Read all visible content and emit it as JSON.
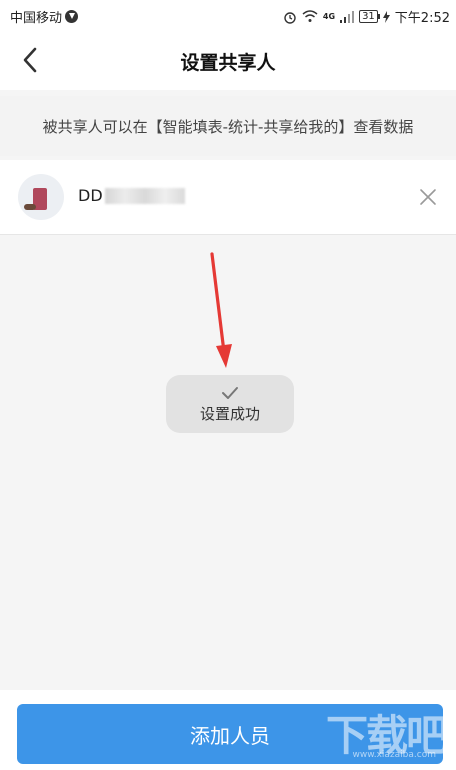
{
  "status_bar": {
    "carrier": "中国移动",
    "battery": "31",
    "time": "下午2:52",
    "network": "4G"
  },
  "header": {
    "title": "设置共享人",
    "back_icon": "chevron-left-icon"
  },
  "notice": {
    "text": "被共享人可以在【智能填表-统计-共享给我的】查看数据"
  },
  "shared_users": [
    {
      "name_visible": "DD",
      "remove_icon": "close-icon"
    }
  ],
  "toast": {
    "icon": "checkmark-icon",
    "text": "设置成功"
  },
  "footer": {
    "add_button_label": "添加人员"
  },
  "watermark": {
    "text": "下载吧",
    "subtext": "www.xiazaiba.com"
  },
  "colors": {
    "primary_button": "#3d95e8",
    "annotation_arrow": "#e53935",
    "background": "#f5f5f5"
  }
}
